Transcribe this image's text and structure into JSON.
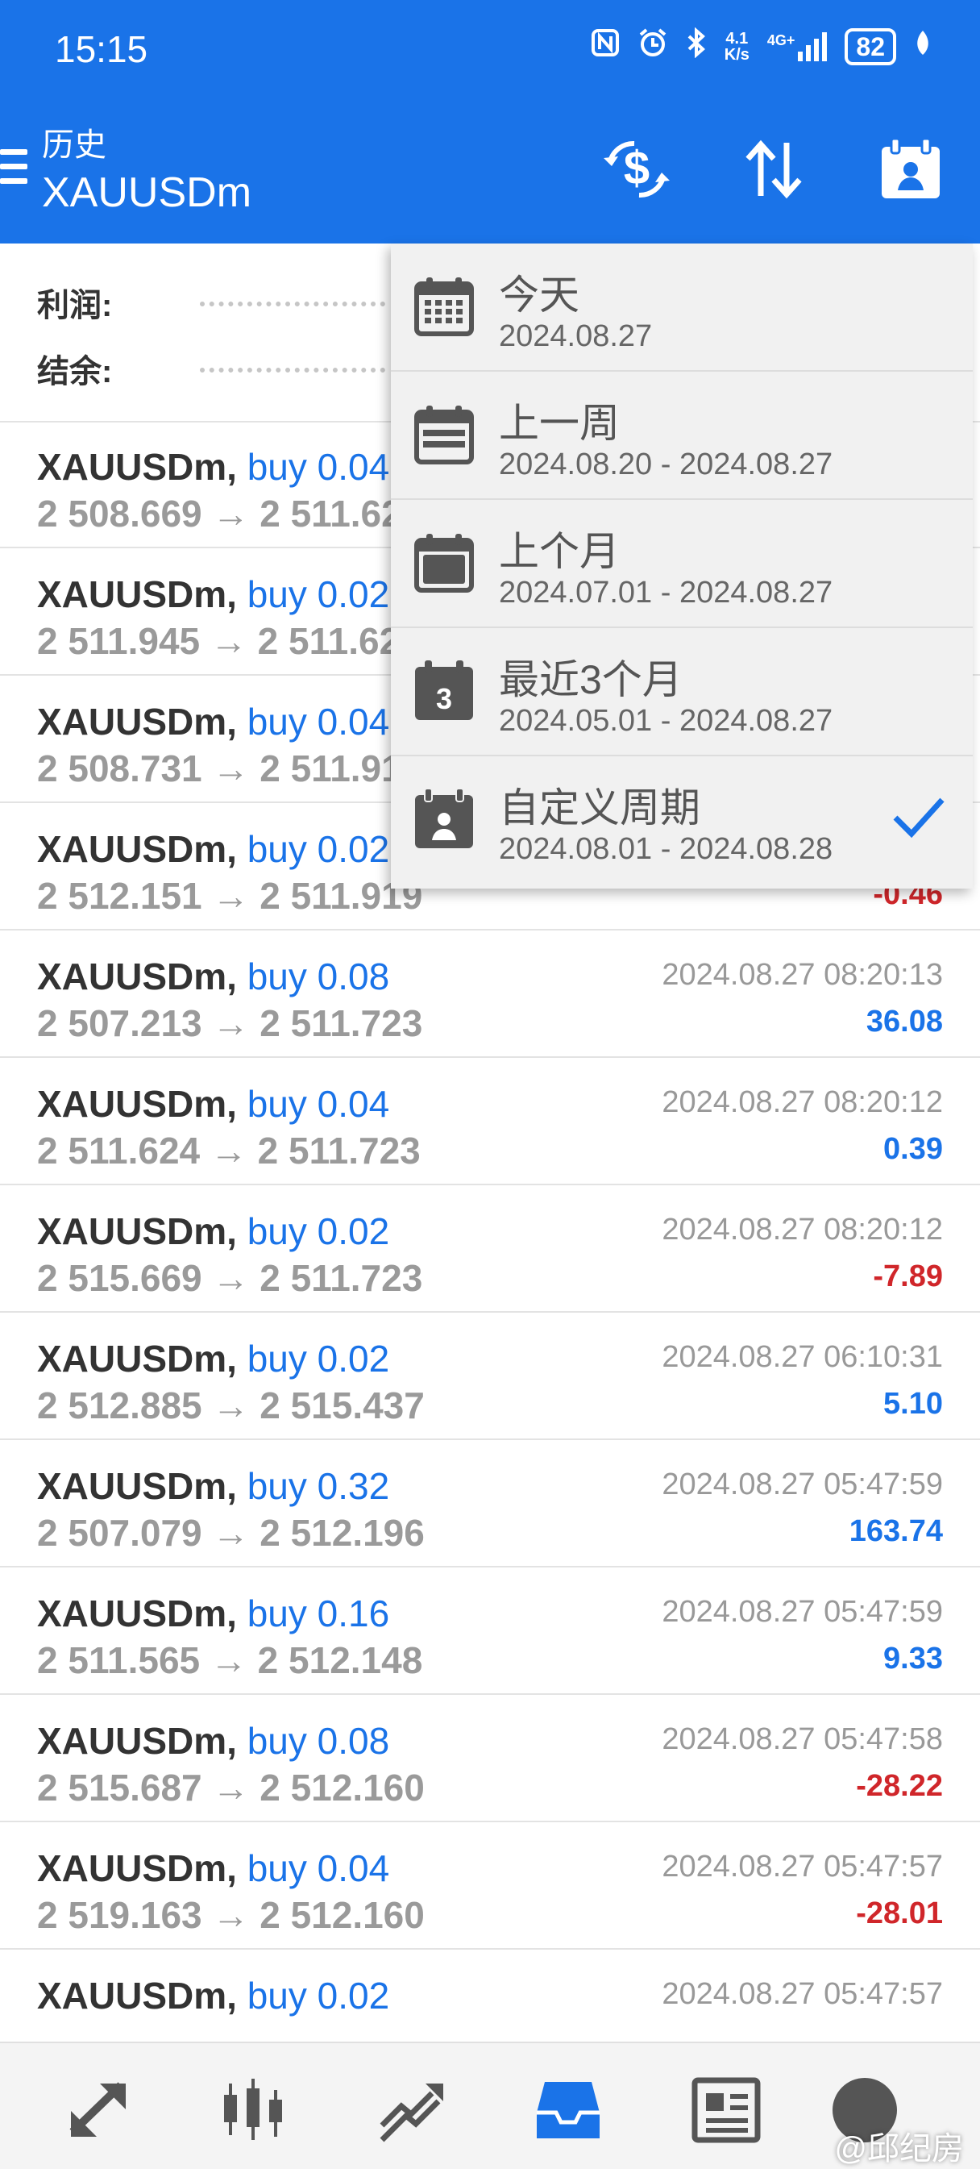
{
  "status_bar": {
    "time": "15:15",
    "network_speed": "4.1\nK/s",
    "network_type": "4G+",
    "battery": "82"
  },
  "app_bar": {
    "title": "历史",
    "subtitle": "XAUUSDm",
    "icons": [
      "dollar-swap-icon",
      "sort-icon",
      "calendar-user-icon"
    ]
  },
  "summary": {
    "profit_label": "利润:",
    "balance_label": "结余:"
  },
  "trades": [
    {
      "symbol": "XAUUSDm,",
      "type": "buy 0.04",
      "prices": "2 508.669 → 2 511.62",
      "time": "",
      "profit": "",
      "sign": "pos"
    },
    {
      "symbol": "XAUUSDm,",
      "type": "buy 0.02",
      "prices": "2 511.945 → 2 511.62",
      "time": "",
      "profit": "",
      "sign": "pos"
    },
    {
      "symbol": "XAUUSDm,",
      "type": "buy 0.04",
      "prices": "2 508.731 → 2 511.91",
      "time": "",
      "profit": "",
      "sign": "pos"
    },
    {
      "symbol": "XAUUSDm,",
      "type": "buy 0.02",
      "prices": "2 512.151 → 2 511.919",
      "time": "",
      "profit": "-0.46",
      "sign": "neg"
    },
    {
      "symbol": "XAUUSDm,",
      "type": "buy 0.08",
      "prices": "2 507.213 → 2 511.723",
      "time": "2024.08.27 08:20:13",
      "profit": "36.08",
      "sign": "pos"
    },
    {
      "symbol": "XAUUSDm,",
      "type": "buy 0.04",
      "prices": "2 511.624 → 2 511.723",
      "time": "2024.08.27 08:20:12",
      "profit": "0.39",
      "sign": "pos"
    },
    {
      "symbol": "XAUUSDm,",
      "type": "buy 0.02",
      "prices": "2 515.669 → 2 511.723",
      "time": "2024.08.27 08:20:12",
      "profit": "-7.89",
      "sign": "neg"
    },
    {
      "symbol": "XAUUSDm,",
      "type": "buy 0.02",
      "prices": "2 512.885 → 2 515.437",
      "time": "2024.08.27 06:10:31",
      "profit": "5.10",
      "sign": "pos"
    },
    {
      "symbol": "XAUUSDm,",
      "type": "buy 0.32",
      "prices": "2 507.079 → 2 512.196",
      "time": "2024.08.27 05:47:59",
      "profit": "163.74",
      "sign": "pos"
    },
    {
      "symbol": "XAUUSDm,",
      "type": "buy 0.16",
      "prices": "2 511.565 → 2 512.148",
      "time": "2024.08.27 05:47:59",
      "profit": "9.33",
      "sign": "pos"
    },
    {
      "symbol": "XAUUSDm,",
      "type": "buy 0.08",
      "prices": "2 515.687 → 2 512.160",
      "time": "2024.08.27 05:47:58",
      "profit": "-28.22",
      "sign": "neg"
    },
    {
      "symbol": "XAUUSDm,",
      "type": "buy 0.04",
      "prices": "2 519.163 → 2 512.160",
      "time": "2024.08.27 05:47:57",
      "profit": "-28.01",
      "sign": "neg"
    },
    {
      "symbol": "XAUUSDm,",
      "type": "buy 0.02",
      "prices": "",
      "time": "2024.08.27 05:47:57",
      "profit": "",
      "sign": "pos"
    }
  ],
  "period_menu": [
    {
      "label": "今天",
      "range": "2024.08.27",
      "icon": "calendar-grid-icon",
      "selected": false
    },
    {
      "label": "上一周",
      "range": "2024.08.20 - 2024.08.27",
      "icon": "calendar-week-icon",
      "selected": false
    },
    {
      "label": "上个月",
      "range": "2024.07.01 - 2024.08.27",
      "icon": "calendar-month-icon",
      "selected": false
    },
    {
      "label": "最近3个月",
      "range": "2024.05.01 - 2024.08.27",
      "icon": "calendar-3-icon",
      "icon_text": "3",
      "selected": false
    },
    {
      "label": "自定义周期",
      "range": "2024.08.01 - 2024.08.28",
      "icon": "calendar-user-icon",
      "selected": true
    }
  ],
  "bottom_nav": [
    "quotes-icon",
    "chart-candles-icon",
    "trade-icon",
    "history-inbox-icon",
    "news-icon",
    "chat-icon"
  ],
  "watermark": "@邱纪房",
  "colors": {
    "accent": "#1a73e8",
    "negative": "#d0262a",
    "menu_bg": "#f1f1f1"
  }
}
